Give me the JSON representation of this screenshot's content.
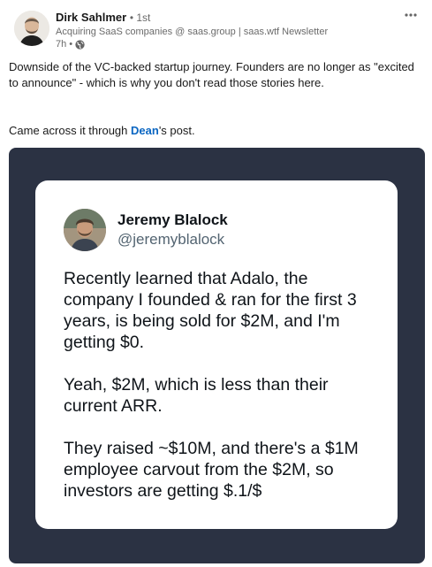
{
  "post": {
    "author": {
      "name": "Dirk Sahlmer",
      "degree": "• 1st",
      "tagline": "Acquiring SaaS companies @ saas.group | saas.wtf Newsletter",
      "time": "7h •"
    },
    "more_icon": "more-horizontal-icon",
    "text": {
      "paragraph1": "Downside of the VC-backed startup journey. Founders are no longer as \"excited to announce\" - which is why you don't read those stories here.",
      "paragraph2_prefix": "Came across it through ",
      "mention": "Dean",
      "paragraph2_suffix": "'s post."
    },
    "image": {
      "background_color": "#2b3243",
      "tweet": {
        "name": "Jeremy Blalock",
        "handle": "@jeremyblalock",
        "paragraphs": [
          "Recently learned that Adalo, the company I founded & ran for the first 3 years, is being sold for $2M, and I'm getting $0.",
          "Yeah, $2M, which is less than their current ARR.",
          "They raised ~$10M, and there's a $1M employee carvout from the $2M, so investors are getting $.1/$"
        ]
      }
    }
  }
}
